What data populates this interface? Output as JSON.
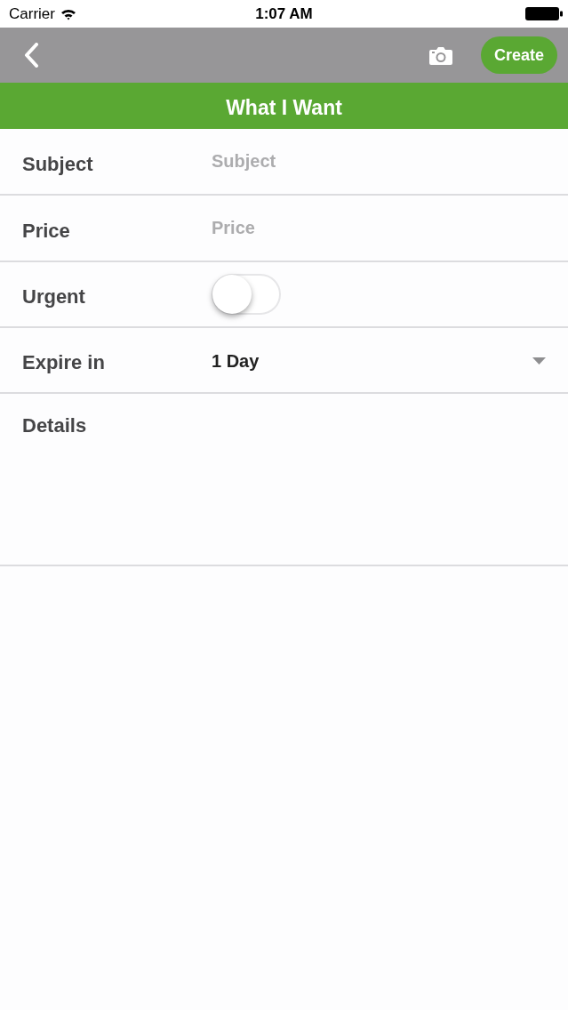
{
  "status_bar": {
    "carrier": "Carrier",
    "time": "1:07 AM"
  },
  "nav_bar": {
    "create_button": "Create"
  },
  "title": "What I Want",
  "fields": [
    {
      "kind": "text",
      "label": "Subject",
      "placeholder": "Subject"
    },
    {
      "kind": "text",
      "label": "Price",
      "placeholder": "Price"
    },
    {
      "kind": "switch",
      "label": "Urgent",
      "on": false
    },
    {
      "kind": "select",
      "label": "Expire in",
      "value": "1 Day"
    },
    {
      "kind": "textarea",
      "label": "Details"
    }
  ]
}
